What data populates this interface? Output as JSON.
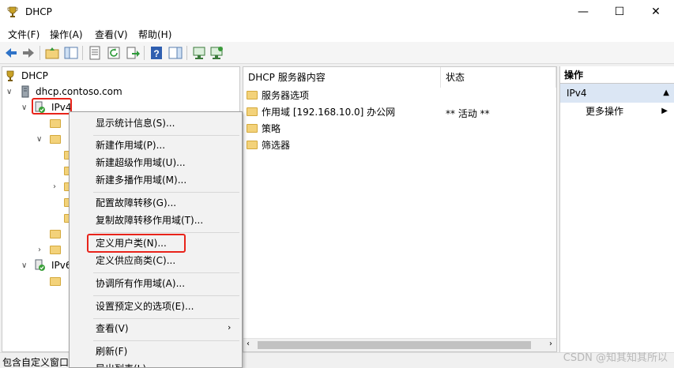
{
  "window": {
    "title": "DHCP",
    "icon": "dhcp-trophy-icon",
    "controls": {
      "minimize": "—",
      "maximize": "☐",
      "close": "✕"
    }
  },
  "menubar": {
    "file": "文件(F)",
    "action": "操作(A)",
    "view": "查看(V)",
    "help": "帮助(H)"
  },
  "tree": {
    "root": "DHCP",
    "server": "dhcp.contoso.com",
    "ipv4": "IPv4",
    "ipv6": "IPv6"
  },
  "content": {
    "columns": [
      "DHCP 服务器内容",
      "状态"
    ],
    "rows": [
      {
        "name": "服务器选项",
        "status": "",
        "icon": "server-options-icon"
      },
      {
        "name": "作用域 [192.168.10.0] 办公网",
        "status": "** 活动 **",
        "icon": "folder-icon"
      },
      {
        "name": "策略",
        "status": "",
        "icon": "folder-icon"
      },
      {
        "name": "筛选器",
        "status": "",
        "icon": "filter-icon"
      }
    ]
  },
  "actions": {
    "header": "操作",
    "section": "IPv4",
    "more": "更多操作"
  },
  "context_menu": {
    "show_stats": "显示统计信息(S)...",
    "new_scope": "新建作用域(P)...",
    "new_superscope": "新建超级作用域(U)...",
    "new_multicast": "新建多播作用域(M)...",
    "configure_failover": "配置故障转移(G)...",
    "replicate_failover": "复制故障转移作用域(T)...",
    "define_user_classes": "定义用户类(N)...",
    "define_vendor_classes": "定义供应商类(C)...",
    "reconcile_all": "协调所有作用域(A)...",
    "set_predefined": "设置预定义的选项(E)...",
    "view": "查看(V)",
    "refresh": "刷新(F)",
    "export_list": "导出列表(L)..."
  },
  "status_bar": "包含自定义窗口",
  "watermark": "CSDN @知其知其所以",
  "colors": {
    "highlight_box": "#e8241b",
    "action_section_bg": "#dbe6f4",
    "folder": "#f3d27a"
  }
}
